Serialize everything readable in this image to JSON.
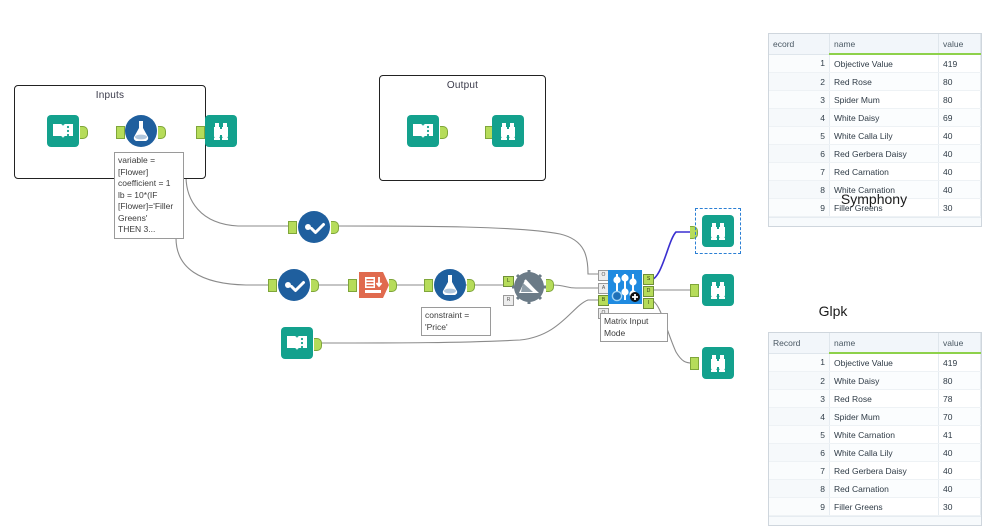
{
  "app": {
    "canvas_label": "alteryx-workflow-canvas"
  },
  "containers": [
    {
      "id": "inputs",
      "title": "Inputs"
    },
    {
      "id": "output",
      "title": "Output"
    }
  ],
  "annotations": [
    {
      "id": "variable-tooltip",
      "text": "variable =\n[Flower]\ncoefficient = 1\nlb = 10*(IF\n[Flower]='Filler\nGreens'\nTHEN 3..."
    },
    {
      "id": "constraint-tooltip",
      "text": "constraint =\n'Price'"
    },
    {
      "id": "matrix-input-mode-tooltip",
      "text": "Matrix Input\nMode"
    }
  ],
  "nodes": [
    {
      "id": "input-data-inputs",
      "icon": "book-icon",
      "label": "Input Data"
    },
    {
      "id": "formula-inputs",
      "icon": "flask-icon",
      "label": "Formula"
    },
    {
      "id": "browse-inputs",
      "icon": "binoculars-icon",
      "label": "Browse"
    },
    {
      "id": "input-data-output",
      "icon": "book-icon",
      "label": "Input Data"
    },
    {
      "id": "browse-output",
      "icon": "binoculars-icon",
      "label": "Browse"
    },
    {
      "id": "select-top",
      "icon": "select-icon",
      "label": "Select"
    },
    {
      "id": "select-mid",
      "icon": "select-icon",
      "label": "Select"
    },
    {
      "id": "sort-mid",
      "icon": "sort-icon",
      "label": "Sort"
    },
    {
      "id": "formula-mid",
      "icon": "flask-icon",
      "label": "Formula"
    },
    {
      "id": "macro-mid",
      "icon": "macro-gear-icon",
      "label": "Macro"
    },
    {
      "id": "input-data-bottom",
      "icon": "book-icon",
      "label": "Input Data"
    },
    {
      "id": "optimization",
      "icon": "sliders-icon",
      "label": "Optimization"
    },
    {
      "id": "browse-symphony",
      "icon": "binoculars-icon",
      "label": "Browse",
      "selected": true
    },
    {
      "id": "browse-glpk",
      "icon": "binoculars-icon",
      "label": "Browse"
    },
    {
      "id": "browse-extra",
      "icon": "binoculars-icon",
      "label": "Browse"
    }
  ],
  "optimization_anchors": {
    "inputs": [
      "O",
      "A",
      "B",
      "Q"
    ],
    "outputs": [
      "S",
      "D",
      "I"
    ]
  },
  "macro_anchors": {
    "inputs": [
      "L",
      "R"
    ]
  },
  "results": [
    {
      "id": "symphony-results",
      "caption": "Symphony",
      "columns": [
        "ecord",
        "name",
        "value"
      ],
      "rows": [
        {
          "record": "1",
          "name": "Objective Value",
          "value": "419"
        },
        {
          "record": "2",
          "name": "Red Rose",
          "value": "80"
        },
        {
          "record": "3",
          "name": "Spider Mum",
          "value": "80"
        },
        {
          "record": "4",
          "name": "White Daisy",
          "value": "69"
        },
        {
          "record": "5",
          "name": "White Calla Lily",
          "value": "40"
        },
        {
          "record": "6",
          "name": "Red Gerbera Daisy",
          "value": "40"
        },
        {
          "record": "7",
          "name": "Red Carnation",
          "value": "40"
        },
        {
          "record": "8",
          "name": "White Carnation",
          "value": "40"
        },
        {
          "record": "9",
          "name": "Filler Greens",
          "value": "30"
        }
      ]
    },
    {
      "id": "glpk-results",
      "caption": "Glpk",
      "columns": [
        "Record",
        "name",
        "value"
      ],
      "rows": [
        {
          "record": "1",
          "name": "Objective Value",
          "value": "419"
        },
        {
          "record": "2",
          "name": "White Daisy",
          "value": "80"
        },
        {
          "record": "3",
          "name": "Red Rose",
          "value": "78"
        },
        {
          "record": "4",
          "name": "Spider Mum",
          "value": "70"
        },
        {
          "record": "5",
          "name": "White Carnation",
          "value": "41"
        },
        {
          "record": "6",
          "name": "White Calla Lily",
          "value": "40"
        },
        {
          "record": "7",
          "name": "Red Gerbera Daisy",
          "value": "40"
        },
        {
          "record": "8",
          "name": "Red Carnation",
          "value": "40"
        },
        {
          "record": "9",
          "name": "Filler Greens",
          "value": "30"
        }
      ]
    }
  ],
  "colors": {
    "teal": "#13a18d",
    "blue": "#1f5f9e",
    "optimization_blue": "#1f8ae0",
    "orange": "#e06a4e",
    "anchor_green": "#b6dc5a",
    "selection_blue": "#2b7fd4",
    "highlight_link": "#3a2fd0",
    "header_green": "#8ed14a"
  }
}
